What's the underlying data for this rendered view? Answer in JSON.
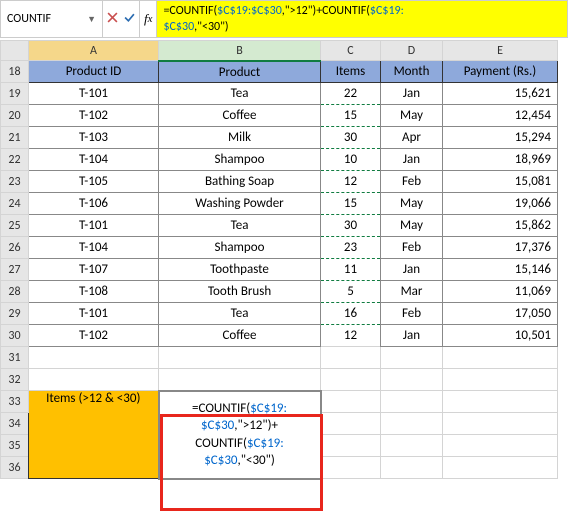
{
  "namebox": {
    "value": "COUNTIF",
    "dropdown": "▼"
  },
  "formula_bar": {
    "prefix": "=COUNTIF(",
    "range1": "$C$19:$C$30",
    "mid1": ",\">12\")+COUNTIF(",
    "range2": "$C$19:",
    "range2b": "$C$30",
    "suffix": ",\"<30\")"
  },
  "columns": [
    "A",
    "B",
    "C",
    "D",
    "E"
  ],
  "row_headers": [
    18,
    19,
    20,
    21,
    22,
    23,
    24,
    25,
    26,
    27,
    28,
    29,
    30,
    31,
    32,
    33,
    34,
    35,
    36
  ],
  "table_headers": {
    "A": "Product ID",
    "B": "Product",
    "C": "Items",
    "D": "Month",
    "E": "Payment (Rs.)"
  },
  "rows": [
    {
      "id": "T-101",
      "product": "Tea",
      "items": "22",
      "month": "Jan",
      "pay": "15,621"
    },
    {
      "id": "T-102",
      "product": "Coffee",
      "items": "15",
      "month": "May",
      "pay": "12,454"
    },
    {
      "id": "T-103",
      "product": "Milk",
      "items": "30",
      "month": "Apr",
      "pay": "15,294"
    },
    {
      "id": "T-104",
      "product": "Shampoo",
      "items": "10",
      "month": "Jan",
      "pay": "18,969"
    },
    {
      "id": "T-105",
      "product": "Bathing Soap",
      "items": "12",
      "month": "Feb",
      "pay": "15,081"
    },
    {
      "id": "T-106",
      "product": "Washing Powder",
      "items": "15",
      "month": "May",
      "pay": "19,066"
    },
    {
      "id": "T-101",
      "product": "Tea",
      "items": "30",
      "month": "May",
      "pay": "15,862"
    },
    {
      "id": "T-104",
      "product": "Shampoo",
      "items": "23",
      "month": "Feb",
      "pay": "17,376"
    },
    {
      "id": "T-107",
      "product": "Toothpaste",
      "items": "11",
      "month": "Jan",
      "pay": "15,146"
    },
    {
      "id": "T-108",
      "product": "Tooth Brush",
      "items": "5",
      "month": "Mar",
      "pay": "11,069"
    },
    {
      "id": "T-101",
      "product": "Tea",
      "items": "16",
      "month": "Feb",
      "pay": "17,050"
    },
    {
      "id": "T-102",
      "product": "Coffee",
      "items": "12",
      "month": "Jan",
      "pay": "10,501"
    }
  ],
  "label": "Items (>12 & <30)",
  "display_formula": {
    "l1a": "=COUNTIF(",
    "l1b": "$C$19:",
    "l2a": "$C$30",
    "l2b": ",\">12\")+",
    "l3a": "COUNTIF(",
    "l3b": "$C$19:",
    "l4a": "$C$30",
    "l4b": ",\"<30\")"
  }
}
